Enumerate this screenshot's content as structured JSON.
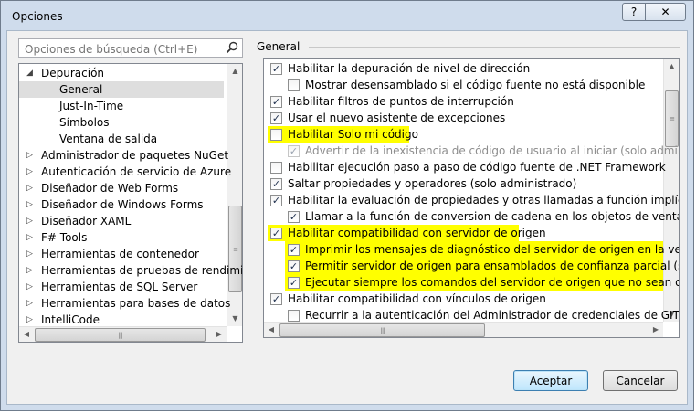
{
  "window": {
    "title": "Opciones",
    "help_label": "?",
    "close_label": "✕"
  },
  "search": {
    "placeholder": "Opciones de búsqueda (Ctrl+E)"
  },
  "tree": {
    "items": [
      {
        "label": "Depuración",
        "level": 0,
        "expanded": true,
        "arrow": "◢"
      },
      {
        "label": "General",
        "level": 1,
        "selected": true
      },
      {
        "label": "Just-In-Time",
        "level": 1
      },
      {
        "label": "Símbolos",
        "level": 1
      },
      {
        "label": "Ventana de salida",
        "level": 1
      },
      {
        "label": "Administrador de paquetes NuGet",
        "level": 0,
        "arrow": "▷"
      },
      {
        "label": "Autenticación de servicio de Azure",
        "level": 0,
        "arrow": "▷"
      },
      {
        "label": "Diseñador de Web Forms",
        "level": 0,
        "arrow": "▷"
      },
      {
        "label": "Diseñador de Windows Forms",
        "level": 0,
        "arrow": "▷"
      },
      {
        "label": "Diseñador XAML",
        "level": 0,
        "arrow": "▷"
      },
      {
        "label": "F# Tools",
        "level": 0,
        "arrow": "▷"
      },
      {
        "label": "Herramientas de contenedor",
        "level": 0,
        "arrow": "▷"
      },
      {
        "label": "Herramientas de pruebas de rendimie",
        "level": 0,
        "arrow": "▷"
      },
      {
        "label": "Herramientas de SQL Server",
        "level": 0,
        "arrow": "▷"
      },
      {
        "label": "Herramientas para bases de datos",
        "level": 0,
        "arrow": "▷"
      },
      {
        "label": "IntelliCode",
        "level": 0,
        "arrow": "▷"
      }
    ]
  },
  "section": {
    "title": "General"
  },
  "options": [
    {
      "label": "Habilitar la depuración de nivel de dirección",
      "indent": 0,
      "checked": true
    },
    {
      "label": "Mostrar desensamblado si el código fuente no está disponible",
      "indent": 1,
      "checked": false
    },
    {
      "label": "Habilitar filtros de puntos de interrupción",
      "indent": 0,
      "checked": true
    },
    {
      "label": "Usar el nuevo asistente de excepciones",
      "indent": 0,
      "checked": true
    },
    {
      "label": "Habilitar Solo mi código",
      "indent": 0,
      "checked": false,
      "highlight": true
    },
    {
      "label": "Advertir de la inexistencia de código de usuario al iniciar (solo administrad",
      "indent": 1,
      "checked": true,
      "disabled": true
    },
    {
      "label": "Habilitar ejecución paso a paso de código fuente de .NET Framework",
      "indent": 0,
      "checked": false
    },
    {
      "label": "Saltar propiedades y operadores (solo administrado)",
      "indent": 0,
      "checked": true
    },
    {
      "label": "Habilitar la evaluación de propiedades y otras llamadas a función implícitas",
      "indent": 0,
      "checked": true
    },
    {
      "label": "Llamar a la función de conversion de cadena en los objetos de ventanas d",
      "indent": 1,
      "checked": true
    },
    {
      "label": "Habilitar compatibilidad con servidor de origen",
      "indent": 0,
      "checked": true,
      "highlight": true
    },
    {
      "label": "Imprimir los mensajes de diagnóstico del servidor de origen en la ventana",
      "indent": 1,
      "checked": true,
      "highlight": true
    },
    {
      "label": "Permitir servidor de origen para ensamblados de confianza parcial (solo a",
      "indent": 1,
      "checked": true,
      "highlight": true
    },
    {
      "label": "Ejecutar siempre los comandos del servidor de origen que no sean de con",
      "indent": 1,
      "checked": true,
      "highlight": true
    },
    {
      "label": "Habilitar compatibilidad con vínculos de origen",
      "indent": 0,
      "checked": true
    },
    {
      "label": "Recurrir a la autenticación del Administrador de credenciales de GIT para",
      "indent": 1,
      "checked": false
    }
  ],
  "buttons": {
    "accept": "Aceptar",
    "cancel": "Cancelar"
  },
  "colors": {
    "highlight": "#ffff00",
    "accent": "#3c7fb1",
    "window_frame": "#cfdcec"
  }
}
